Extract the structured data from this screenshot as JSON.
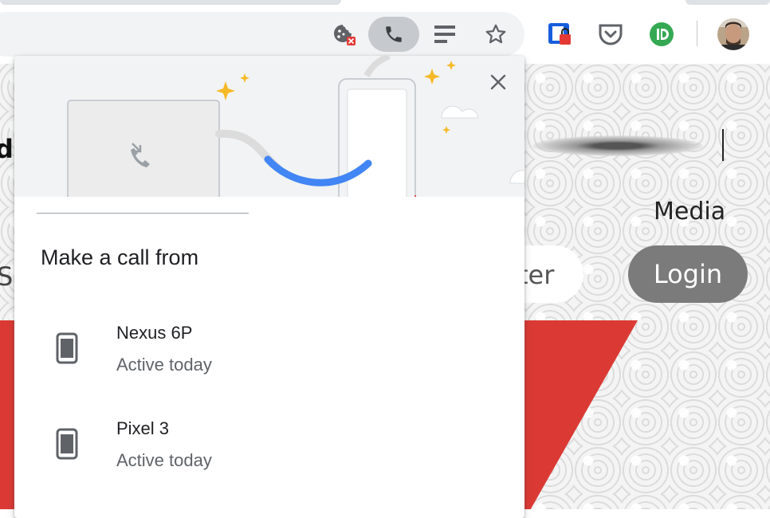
{
  "browser": {
    "toolbar_icons": [
      "cookie-blocked-icon",
      "phone-icon",
      "reading-list-icon",
      "star-icon",
      "bitwarden-icon",
      "pocket-icon",
      "extension-d-icon",
      "profile-avatar"
    ]
  },
  "page": {
    "left_fragment_top": "du",
    "left_fragment_mid": "Sc",
    "nav_media": "Media",
    "button_partial": "ter",
    "button_login": "Login"
  },
  "call_bubble": {
    "title": "Make a call from",
    "devices": [
      {
        "name": "Nexus 6P",
        "status": "Active today"
      },
      {
        "name": "Pixel 3",
        "status": "Active today"
      }
    ]
  },
  "colors": {
    "accent_blue": "#4285f4",
    "sparkle": "#f6b926",
    "page_red": "#db3a34",
    "login_bg": "#7b7b7b"
  }
}
